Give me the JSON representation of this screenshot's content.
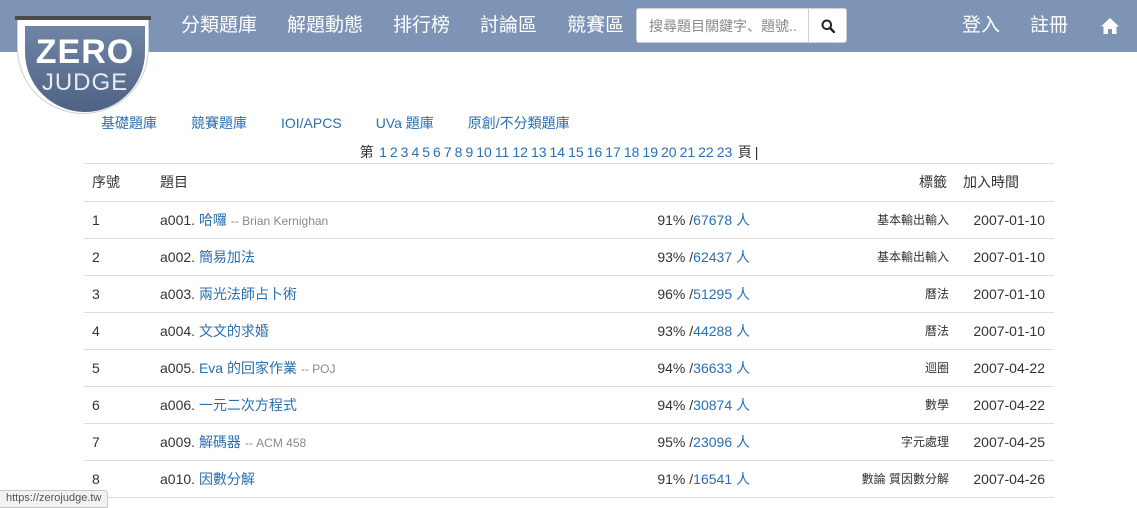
{
  "logo": {
    "line1": "ZERO",
    "line2": "JUDGE"
  },
  "navbar": {
    "items": [
      "分類題庫",
      "解題動態",
      "排行榜",
      "討論區",
      "競賽區"
    ],
    "search_placeholder": "搜尋題目關鍵字、題號...",
    "login": "登入",
    "register": "註冊",
    "search_icon": "search-icon",
    "home_icon": "home-icon"
  },
  "subnav": [
    "基礎題庫",
    "競賽題庫",
    "IOI/APCS",
    "UVa 題庫",
    "原創/不分類題庫"
  ],
  "pager": {
    "prefix": "第",
    "pages": [
      "1",
      "2",
      "3",
      "4",
      "5",
      "6",
      "7",
      "8",
      "9",
      "10",
      "11",
      "12",
      "13",
      "14",
      "15",
      "16",
      "17",
      "18",
      "19",
      "20",
      "21",
      "22",
      "23"
    ],
    "suffix": "頁",
    "cursor": "|"
  },
  "table": {
    "headers": {
      "num": "序號",
      "title": "題目",
      "tags": "標籤",
      "date": "加入時間"
    },
    "rows": [
      {
        "num": "1",
        "id": "a001.",
        "title": "哈囉",
        "source": "-- Brian Kernighan",
        "pct": "91% /",
        "users": "67678 人",
        "tags": "基本輸出輸入",
        "date": "2007-01-10"
      },
      {
        "num": "2",
        "id": "a002.",
        "title": "簡易加法",
        "source": "",
        "pct": "93% /",
        "users": "62437 人",
        "tags": "基本輸出輸入",
        "date": "2007-01-10"
      },
      {
        "num": "3",
        "id": "a003.",
        "title": "兩光法師占卜術",
        "source": "",
        "pct": "96% /",
        "users": "51295 人",
        "tags": "曆法",
        "date": "2007-01-10"
      },
      {
        "num": "4",
        "id": "a004.",
        "title": "文文的求婚",
        "source": "",
        "pct": "93% /",
        "users": "44288 人",
        "tags": "曆法",
        "date": "2007-01-10"
      },
      {
        "num": "5",
        "id": "a005.",
        "title": "Eva 的回家作業",
        "source": "-- POJ",
        "pct": "94% /",
        "users": "36633 人",
        "tags": "迴圈",
        "date": "2007-04-22"
      },
      {
        "num": "6",
        "id": "a006.",
        "title": "一元二次方程式",
        "source": "",
        "pct": "94% /",
        "users": "30874 人",
        "tags": "數學",
        "date": "2007-04-22"
      },
      {
        "num": "7",
        "id": "a009.",
        "title": "解碼器",
        "source": "-- ACM 458",
        "pct": "95% /",
        "users": "23096 人",
        "tags": "字元處理",
        "date": "2007-04-25"
      },
      {
        "num": "8",
        "id": "a010.",
        "title": "因數分解",
        "source": "",
        "pct": "91% /",
        "users": "16541 人",
        "tags": "數論 質因數分解",
        "date": "2007-04-26"
      }
    ]
  },
  "status_url": "https://zerojudge.tw",
  "colors": {
    "navbar": "#7d94b6",
    "link": "#2a6fb0",
    "text": "#333333"
  }
}
